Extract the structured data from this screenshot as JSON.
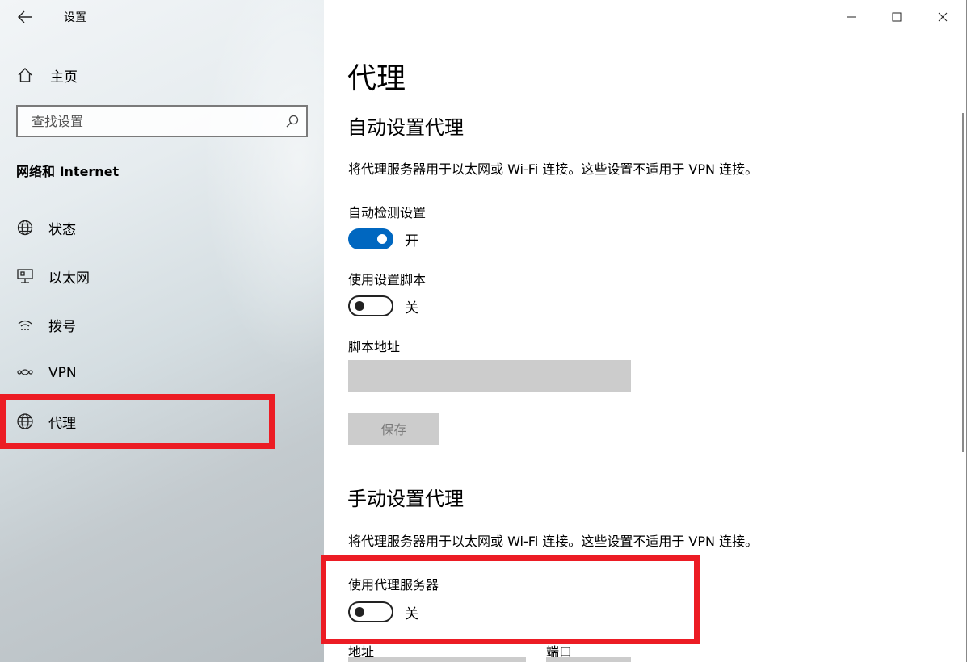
{
  "app": {
    "title": "设置"
  },
  "sidebar": {
    "home_label": "主页",
    "search_placeholder": "查找设置",
    "section_title": "网络和 Internet",
    "items": [
      {
        "label": "状态",
        "icon": "globe-status-icon"
      },
      {
        "label": "以太网",
        "icon": "ethernet-icon"
      },
      {
        "label": "拨号",
        "icon": "dialup-icon"
      },
      {
        "label": "VPN",
        "icon": "vpn-icon"
      },
      {
        "label": "代理",
        "icon": "globe-icon",
        "selected": true
      }
    ]
  },
  "content": {
    "page_title": "代理",
    "auto": {
      "heading": "自动设置代理",
      "description": "将代理服务器用于以太网或 Wi-Fi 连接。这些设置不适用于 VPN 连接。",
      "detect_label": "自动检测设置",
      "detect_state": "开",
      "detect_on": true,
      "script_label": "使用设置脚本",
      "script_state": "关",
      "script_on": false,
      "address_label": "脚本地址",
      "address_value": "",
      "save_label": "保存"
    },
    "manual": {
      "heading": "手动设置代理",
      "description": "将代理服务器用于以太网或 Wi-Fi 连接。这些设置不适用于 VPN 连接。",
      "proxy_label": "使用代理服务器",
      "proxy_state": "关",
      "proxy_on": false,
      "address_label": "地址",
      "port_label": "端口"
    }
  },
  "colors": {
    "accent": "#0067c0",
    "annotation": "#ec1c24",
    "disabled_fill": "#cccccc"
  }
}
